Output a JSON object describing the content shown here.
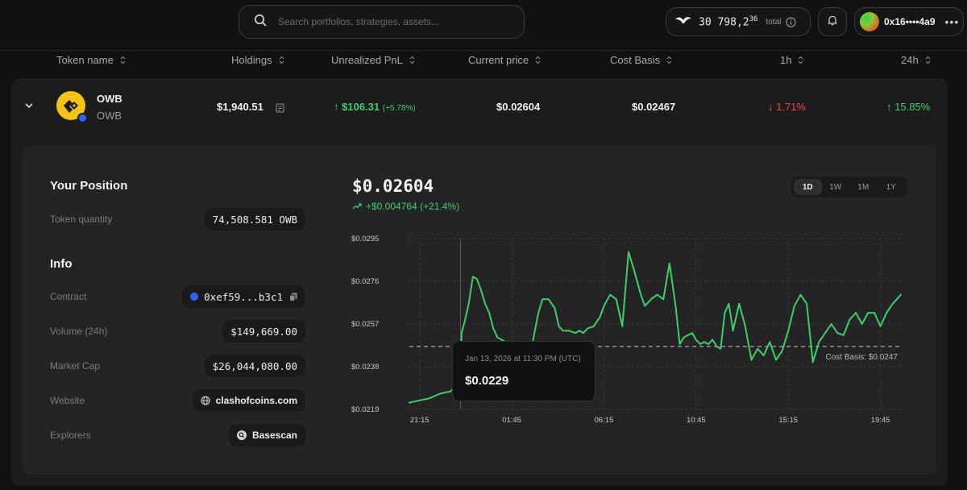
{
  "search": {
    "placeholder": "Search portfolios, strategies, assets..."
  },
  "header": {
    "total_value": "30 798,2",
    "total_value_sup": "36",
    "total_label": "total",
    "wallet_address": "0x16••••4a9",
    "icons": [
      "search-icon",
      "wing-logo-icon",
      "info-icon",
      "bell-icon",
      "more-icon"
    ]
  },
  "columns": [
    "Token name",
    "Holdings",
    "Unrealized PnL",
    "Current price",
    "Cost Basis",
    "1h",
    "24h"
  ],
  "token_row": {
    "name": "OWB",
    "symbol": "OWB",
    "holdings": "$1,940.51",
    "pnl": "$106.31",
    "pnl_pct": "(+5.78%)",
    "current_price": "$0.02604",
    "cost_basis": "$0.02467",
    "change_1h": "1.71%",
    "change_24h": "15.85%",
    "colors": {
      "positive": "#3ecf6b",
      "negative": "#ef4444"
    }
  },
  "position": {
    "title": "Your Position",
    "quantity_label": "Token quantity",
    "quantity_value": "74,508.581 OWB"
  },
  "info": {
    "title": "Info",
    "contract_label": "Contract",
    "contract_value": "0xef59...b3c1",
    "volume_label": "Volume (24h)",
    "volume_value": "$149,669.00",
    "mcap_label": "Market Cap",
    "mcap_value": "$26,044,080.00",
    "website_label": "Website",
    "website_value": "clashofcoins.com",
    "explorers_label": "Explorers",
    "explorers_value": "Basescan"
  },
  "price_panel": {
    "price": "$0.02604",
    "change": "+$0.004764 (+21.4%)",
    "ranges": [
      "1D",
      "1W",
      "1M",
      "1Y"
    ],
    "active_range": "1D"
  },
  "tooltip": {
    "date": "Jan 13, 2026 at 11:30 PM (UTC)",
    "price": "$0.0229"
  },
  "chart_data": {
    "type": "line",
    "title": "",
    "xlabel": "",
    "ylabel": "",
    "y_ticks": [
      "$0.0295",
      "$0.0276",
      "$0.0257",
      "$0.0238",
      "$0.0219"
    ],
    "x_ticks": [
      "21:15",
      "01:45",
      "06:15",
      "10:45",
      "15:15",
      "19:45"
    ],
    "ylim": [
      0.0219,
      0.0295
    ],
    "xlim_hours": [
      -0.5,
      23.5
    ],
    "x_hours": [
      -0.5,
      0.0,
      0.5,
      1.0,
      1.5,
      1.75,
      2.0,
      2.05,
      2.2,
      2.4,
      2.6,
      2.8,
      3.0,
      3.2,
      3.4,
      3.6,
      3.8,
      4.0,
      4.4,
      4.8,
      5.2,
      5.5,
      5.8,
      6.0,
      6.3,
      6.6,
      6.8,
      7.0,
      7.3,
      7.6,
      7.8,
      8.0,
      8.2,
      8.5,
      8.8,
      9.0,
      9.3,
      9.6,
      9.9,
      10.2,
      10.5,
      10.8,
      11.0,
      11.3,
      11.6,
      11.9,
      12.2,
      12.5,
      12.7,
      12.9,
      13.1,
      13.3,
      13.5,
      13.7,
      13.9,
      14.1,
      14.3,
      14.5,
      14.7,
      14.9,
      15.1,
      15.3,
      15.6,
      15.9,
      16.2,
      16.5,
      16.8,
      17.1,
      17.4,
      17.7,
      18.0,
      18.3,
      18.6,
      18.9,
      19.2,
      19.5,
      19.8,
      20.1,
      20.4,
      20.7,
      21.0,
      21.3,
      21.6,
      21.9,
      22.2,
      22.5,
      22.8,
      23.1,
      23.5
    ],
    "values": [
      0.0222,
      0.0223,
      0.0224,
      0.0226,
      0.0227,
      0.0229,
      0.0232,
      0.0253,
      0.0258,
      0.0266,
      0.0278,
      0.0277,
      0.0272,
      0.0266,
      0.0262,
      0.0255,
      0.0251,
      0.025,
      0.0248,
      0.0247,
      0.0249,
      0.0248,
      0.0262,
      0.0268,
      0.0268,
      0.0264,
      0.0256,
      0.0254,
      0.0254,
      0.0253,
      0.0254,
      0.0253,
      0.0255,
      0.0256,
      0.026,
      0.0265,
      0.027,
      0.0268,
      0.0256,
      0.0289,
      0.028,
      0.027,
      0.0265,
      0.0268,
      0.027,
      0.0268,
      0.0284,
      0.0265,
      0.0248,
      0.0251,
      0.0252,
      0.0253,
      0.025,
      0.0248,
      0.0249,
      0.0248,
      0.025,
      0.0247,
      0.0246,
      0.0262,
      0.0266,
      0.0254,
      0.0266,
      0.0256,
      0.0241,
      0.0246,
      0.0243,
      0.0249,
      0.0241,
      0.0245,
      0.0254,
      0.0265,
      0.027,
      0.0266,
      0.024,
      0.0249,
      0.0253,
      0.0257,
      0.0253,
      0.0252,
      0.0259,
      0.0262,
      0.0257,
      0.0262,
      0.0262,
      0.0256,
      0.0262,
      0.0266,
      0.027
    ],
    "reference_line": {
      "label": "Cost Basis: $0.0247",
      "value": 0.0247
    },
    "hover_point_hours": 2.0,
    "grid": true,
    "line_color": "#3ecf6b"
  }
}
